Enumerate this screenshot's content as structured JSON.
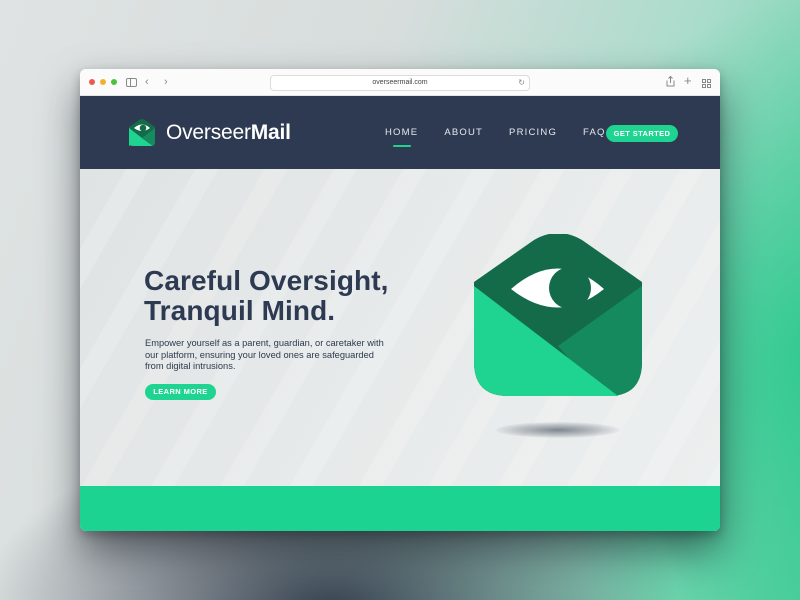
{
  "browser": {
    "url": "overseermail.com",
    "traffic_lights": [
      "close",
      "minimize",
      "zoom"
    ],
    "icons": [
      "sidebar-icon",
      "back-icon",
      "forward-icon",
      "reload-icon",
      "share-icon",
      "new-tab-icon",
      "tab-overview-icon"
    ]
  },
  "header": {
    "brand_light": "Overseer",
    "brand_bold": "Mail",
    "nav": [
      {
        "label": "HOME",
        "active": true
      },
      {
        "label": "ABOUT",
        "active": false
      },
      {
        "label": "PRICING",
        "active": false
      },
      {
        "label": "FAQ",
        "active": false
      }
    ],
    "cta_label": "GET STARTED"
  },
  "hero": {
    "headline_line1": "Careful Oversight,",
    "headline_line2": "Tranquil Mind.",
    "subtext": "Empower yourself as a parent, guardian, or caretaker with our platform, ensuring your loved ones are safeguarded from digital intrusions.",
    "button_label": "LEARN MORE",
    "illustration": "envelope-eye-icon"
  },
  "colors": {
    "header_bg": "#2e3a52",
    "accent_green": "#1fd390",
    "dark_green": "#146b4a",
    "mid_green": "#158a5f",
    "headline_text": "#2d3a52"
  }
}
